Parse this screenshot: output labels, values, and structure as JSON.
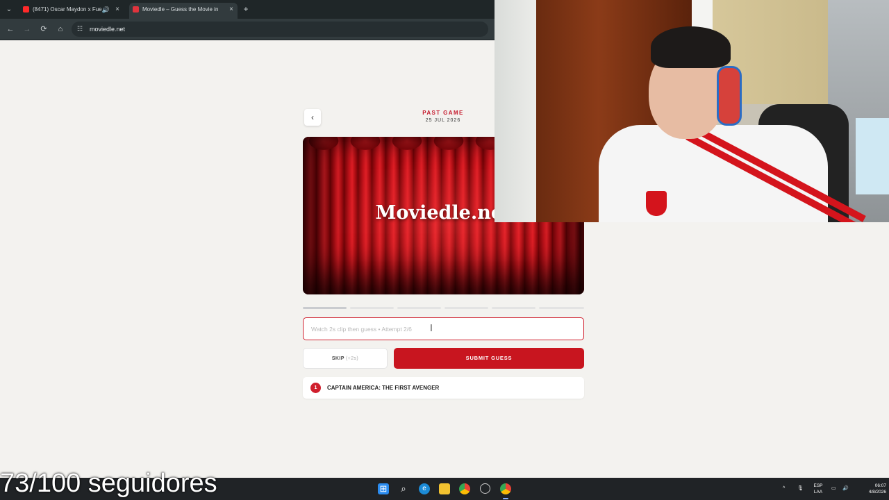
{
  "browser": {
    "tabs": [
      {
        "title": "(8471) Oscar Maydon x Fue",
        "favicon_color": "#ff2a2a",
        "audio": true
      },
      {
        "title": "Moviedle – Guess the Movie in",
        "favicon_color": "#e0343d"
      }
    ],
    "url": "moviedle.net",
    "icons": {
      "tab_search": "chevron-down",
      "close": "×",
      "new_tab": "+",
      "back": "←",
      "forward": "→",
      "reload": "⟳",
      "home": "⌂",
      "site_info": "☷"
    }
  },
  "game": {
    "header_label": "PAST GAME",
    "header_date": "25 JUL 2026",
    "player_logo": "Moviedle.net",
    "progress": {
      "total_segments": 6,
      "completed_segments": 1
    },
    "input_placeholder": "Watch 2s clip then guess • Attempt 2/6",
    "skip_label": "SKIP",
    "skip_extra": "(+2s)",
    "submit_label": "SUBMIT GUESS",
    "guesses": [
      {
        "number": "1",
        "title": "CAPTAIN AMERICA: THE FIRST AVENGER",
        "status_color": "#d01f2d"
      }
    ]
  },
  "overlay": {
    "followers_text": "73/100 seguidores"
  },
  "taskbar": {
    "language": [
      "ESP",
      "LAA"
    ],
    "time": "06:07",
    "date": "4/8/2026"
  },
  "colors": {
    "accent": "#c8151f",
    "page_bg": "#f3f2ef",
    "chrome_bg": "#323b3e"
  }
}
